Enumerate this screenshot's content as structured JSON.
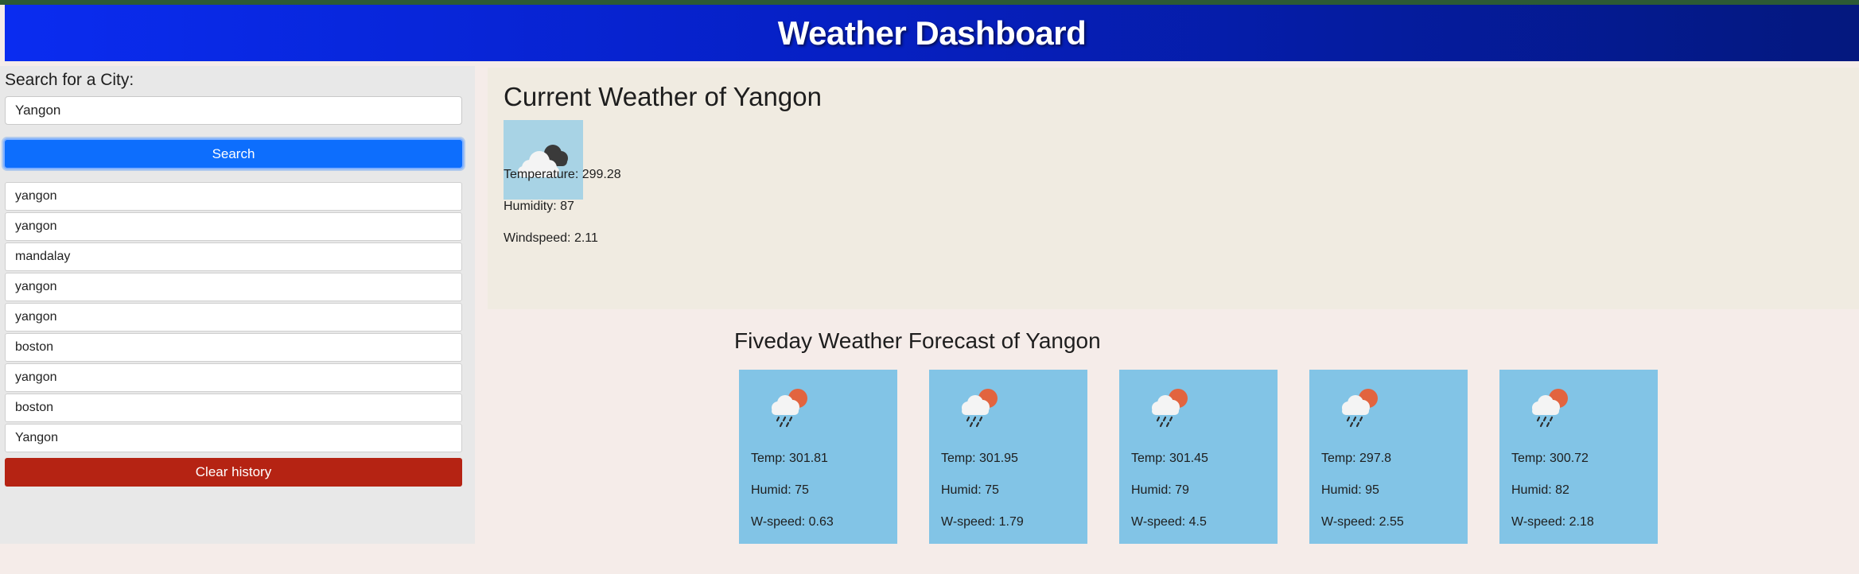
{
  "header": {
    "title": "Weather Dashboard"
  },
  "sidebar": {
    "search_label": "Search for a City:",
    "search_value": "Yangon",
    "search_button": "Search",
    "history": [
      "yangon",
      "yangon",
      "mandalay",
      "yangon",
      "yangon",
      "boston",
      "yangon",
      "boston",
      "Yangon"
    ],
    "clear_button": "Clear history"
  },
  "current": {
    "title": "Current Weather of Yangon",
    "icon": "cloudy-icon",
    "temperature": "Temperature: 299.28",
    "humidity": "Humidity: 87",
    "windspeed": "Windspeed: 2.11"
  },
  "forecast": {
    "title": "Fiveday Weather Forecast of Yangon",
    "icon": "rain-sun-icon",
    "days": [
      {
        "temp": "Temp: 301.81",
        "humid": "Humid: 75",
        "wspeed": "W-speed: 0.63"
      },
      {
        "temp": "Temp: 301.95",
        "humid": "Humid: 75",
        "wspeed": "W-speed: 1.79"
      },
      {
        "temp": "Temp: 301.45",
        "humid": "Humid: 79",
        "wspeed": "W-speed: 4.5"
      },
      {
        "temp": "Temp: 297.8",
        "humid": "Humid: 95",
        "wspeed": "W-speed: 2.55"
      },
      {
        "temp": "Temp: 300.72",
        "humid": "Humid: 82",
        "wspeed": "W-speed: 2.18"
      }
    ]
  },
  "colors": {
    "header_start": "#0a2cf0",
    "header_end": "#04187e",
    "search_button": "#0d6efd",
    "clear_button": "#b52313",
    "forecast_card": "#82c4e6",
    "current_panel": "#f0ebe1"
  }
}
